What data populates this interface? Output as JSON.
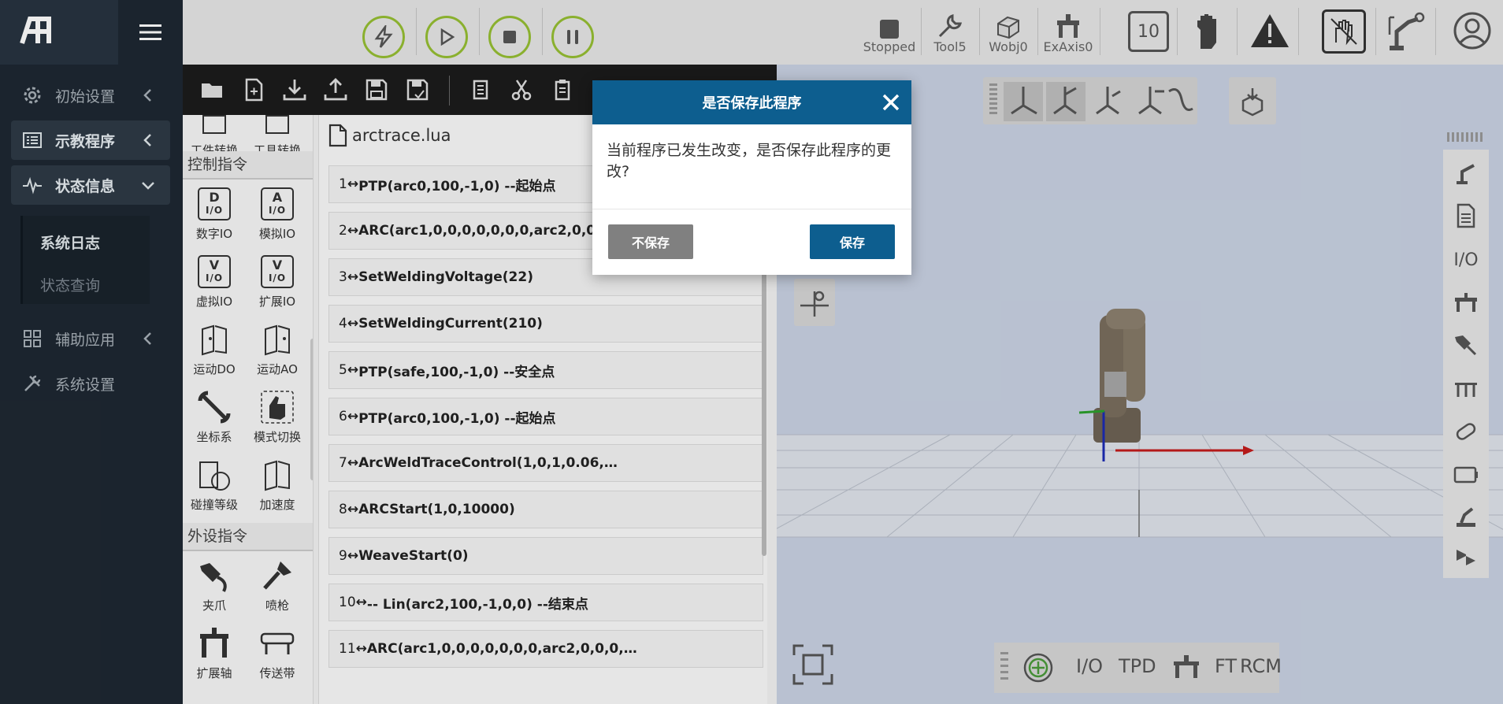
{
  "sidebar": {
    "items": [
      {
        "label": "初始设置",
        "icon": "gear-icon"
      },
      {
        "label": "示教程序",
        "icon": "list-icon"
      },
      {
        "label": "状态信息",
        "icon": "pulse-icon"
      },
      {
        "label": "辅助应用",
        "icon": "grid-icon"
      },
      {
        "label": "系统设置",
        "icon": "tools-icon"
      }
    ],
    "sub_items": [
      "系统日志",
      "状态查询"
    ]
  },
  "toolbar": {
    "status_label": "Stopped",
    "tool_label": "Tool5",
    "wobj_label": "Wobj0",
    "exaxis_label": "ExAxis0",
    "speed_value": "10"
  },
  "palette": {
    "top_items": [
      "工件转换",
      "工具转换"
    ],
    "control_header": "控制指令",
    "control_items": [
      "数字IO",
      "模拟IO",
      "虚拟IO",
      "扩展IO",
      "运动DO",
      "运动AO",
      "坐标系",
      "模式切换",
      "碰撞等级",
      "加速度"
    ],
    "peripheral_header": "外设指令",
    "peripheral_items": [
      "夹爪",
      "喷枪",
      "扩展轴",
      "传送带"
    ],
    "io_boxes": {
      "d": "D",
      "a": "A",
      "v": "V",
      "io": "I/O"
    }
  },
  "editor": {
    "filename": "arctrace.lua",
    "lines": [
      {
        "num": "1",
        "code": "PTP(arc0,100,-1,0) --起始点"
      },
      {
        "num": "2",
        "code": "ARC(arc1,0,0,0,0,0,0,0,arc2,0,0,0,…"
      },
      {
        "num": "3",
        "code": "SetWeldingVoltage(22)"
      },
      {
        "num": "4",
        "code": "SetWeldingCurrent(210)"
      },
      {
        "num": "5",
        "code": "PTP(safe,100,-1,0) --安全点"
      },
      {
        "num": "6",
        "code": "PTP(arc0,100,-1,0) --起始点"
      },
      {
        "num": "7",
        "code": "ArcWeldTraceControl(1,0,1,0.06,…"
      },
      {
        "num": "8",
        "code": "ARCStart(1,0,10000)"
      },
      {
        "num": "9",
        "code": "WeaveStart(0)"
      },
      {
        "num": "10",
        "code": "-- Lin(arc2,100,-1,0,0) --结束点"
      },
      {
        "num": "11",
        "code": "ARC(arc1,0,0,0,0,0,0,0,arc2,0,0,0,…"
      }
    ]
  },
  "view": {
    "side_labels": {
      "io": "I/O"
    },
    "bottom_labels": [
      "I/O",
      "TPD",
      "FT",
      "RCM"
    ]
  },
  "dialog": {
    "title": "是否保存此程序",
    "message": "当前程序已发生改变，是否保存此程序的更改?",
    "dont_save_label": "不保存",
    "save_label": "保存"
  },
  "colors": {
    "accent": "#96bf32",
    "dialog_header": "#0d5e8f",
    "sidebar": "#1e2832"
  }
}
